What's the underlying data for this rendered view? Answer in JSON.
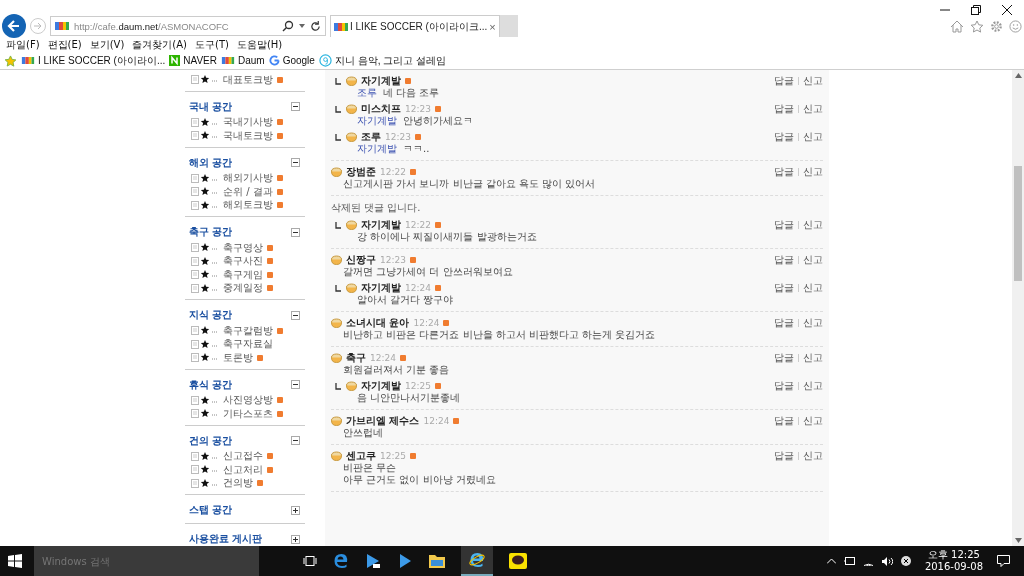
{
  "browser": {
    "url": "http://cafe.**daum.net**/ASMONACOFC",
    "tab": {
      "title": "I LIKE SOCCER (아이라이크...",
      "close": "×"
    }
  },
  "menu": [
    "파일(F)",
    "편집(E)",
    "보기(V)",
    "즐겨찾기(A)",
    "도구(T)",
    "도움말(H)"
  ],
  "favorites": [
    {
      "kind": "daum",
      "label": "I LIKE SOCCER (아이라이..."
    },
    {
      "kind": "naver",
      "label": "NAVER"
    },
    {
      "kind": "daum",
      "label": "Daum"
    },
    {
      "kind": "google",
      "label": "Google"
    },
    {
      "kind": "genie",
      "label": "지니  음악, 그리고 설레임"
    }
  ],
  "sidebar": {
    "top_items": [
      {
        "label": "대표토크방",
        "new": true
      }
    ],
    "sections": [
      {
        "title": "국내 공간",
        "expanded": true,
        "items": [
          {
            "label": "국내기사방",
            "new": true
          },
          {
            "label": "국내토크방",
            "new": true
          }
        ]
      },
      {
        "title": "해외 공간",
        "expanded": true,
        "items": [
          {
            "label": "해외기사방",
            "new": true
          },
          {
            "label": "순위 / 결과",
            "new": true
          },
          {
            "label": "해외토크방",
            "new": true
          }
        ]
      },
      {
        "title": "축구 공간",
        "expanded": true,
        "items": [
          {
            "label": "축구영상",
            "new": true
          },
          {
            "label": "축구사진",
            "new": true
          },
          {
            "label": "축구게임",
            "new": true
          },
          {
            "label": "중계일정",
            "new": true
          }
        ]
      },
      {
        "title": "지식 공간",
        "expanded": true,
        "items": [
          {
            "label": "축구칼럼방",
            "new": true
          },
          {
            "label": "축구자료실",
            "new": false
          },
          {
            "label": "토론방",
            "new": true
          }
        ]
      },
      {
        "title": "휴식 공간",
        "expanded": true,
        "items": [
          {
            "label": "사진영상방",
            "new": true
          },
          {
            "label": "기타스포츠",
            "new": true
          }
        ]
      },
      {
        "title": "건의 공간",
        "expanded": true,
        "items": [
          {
            "label": "신고접수",
            "new": true
          },
          {
            "label": "신고처리",
            "new": true
          },
          {
            "label": "건의방",
            "new": true
          }
        ]
      },
      {
        "title": "스탭 공간",
        "expanded": false
      },
      {
        "title": "사용완료 게시판",
        "expanded": false
      }
    ]
  },
  "threads": [
    {
      "comments": [
        {
          "kind": "reply",
          "author": "자기계발",
          "new": true,
          "mention": "조루",
          "lines": [
            "네 다음 조루"
          ],
          "actions": [
            "답글",
            "신고"
          ]
        },
        {
          "kind": "reply",
          "author": "미스치프",
          "time": "12:23",
          "new": true,
          "mention": "자기계발",
          "lines": [
            "안녕히가세요ㅋ"
          ],
          "actions": [
            "답글",
            "신고"
          ]
        },
        {
          "kind": "reply",
          "author": "조루",
          "time": "12:23",
          "new": true,
          "mention": "자기계발",
          "lines": [
            "ㅋㅋ.."
          ],
          "actions": [
            "답글",
            "신고"
          ]
        }
      ]
    },
    {
      "comments": [
        {
          "kind": "comment",
          "author": "장범준",
          "time": "12:22",
          "new": true,
          "lines": [
            "신고게시판 가서 보니까 비난글 같아요 욕도 많이 있어서"
          ],
          "actions": [
            "답글",
            "신고"
          ]
        }
      ]
    },
    {
      "comments": [
        {
          "kind": "deleted",
          "lines": [
            "삭제된 댓글 입니다."
          ]
        },
        {
          "kind": "reply",
          "author": "자기계발",
          "time": "12:22",
          "new": true,
          "lines": [
            "강 하이에나 찌질이새끼들 발광하는거죠"
          ],
          "actions": [
            "답글",
            "신고"
          ]
        }
      ]
    },
    {
      "comments": [
        {
          "kind": "comment",
          "author": "신짱구",
          "time": "12:23",
          "new": true,
          "lines": [
            "갈꺼면 그냥가세여 더 안쓰러워보여요"
          ],
          "actions": [
            "답글",
            "신고"
          ]
        },
        {
          "kind": "reply",
          "author": "자기계발",
          "time": "12:24",
          "new": true,
          "lines": [
            "알아서 갈거다 짱구야"
          ],
          "actions": [
            "답글",
            "신고"
          ]
        }
      ]
    },
    {
      "comments": [
        {
          "kind": "comment",
          "author": "소녀시대 윤아",
          "time": "12:24",
          "new": true,
          "lines": [
            "비난하고 비판은 다른거죠 비난을 하고서 비판했다고 하는게 웃김거죠"
          ],
          "actions": [
            "답글",
            "신고"
          ]
        }
      ]
    },
    {
      "comments": [
        {
          "kind": "comment",
          "author": "축구",
          "time": "12:24",
          "new": true,
          "lines": [
            "회원걸러져서 기분 좋음"
          ],
          "actions": [
            "답글",
            "신고"
          ]
        },
        {
          "kind": "reply",
          "author": "자기계발",
          "time": "12:25",
          "new": true,
          "lines": [
            "음 니안만나서기분좋네"
          ],
          "actions": [
            "답글",
            "신고"
          ]
        }
      ]
    },
    {
      "comments": [
        {
          "kind": "comment",
          "author": "가브리엘 제수스",
          "time": "12:24",
          "new": true,
          "lines": [
            "안쓰럽네"
          ],
          "actions": [
            "답글",
            "신고"
          ]
        }
      ]
    },
    {
      "comments": [
        {
          "kind": "comment",
          "author": "센고쿠",
          "time": "12:25",
          "new": true,
          "lines": [
            "비판은 무슨",
            "아무 근거도 없이 비아냥 거렸네요"
          ],
          "actions": [
            "답글",
            "신고"
          ]
        }
      ]
    }
  ],
  "taskbar": {
    "search_placeholder": "Windows 검색",
    "time": "오후 12:25",
    "date": "2016-09-08"
  }
}
